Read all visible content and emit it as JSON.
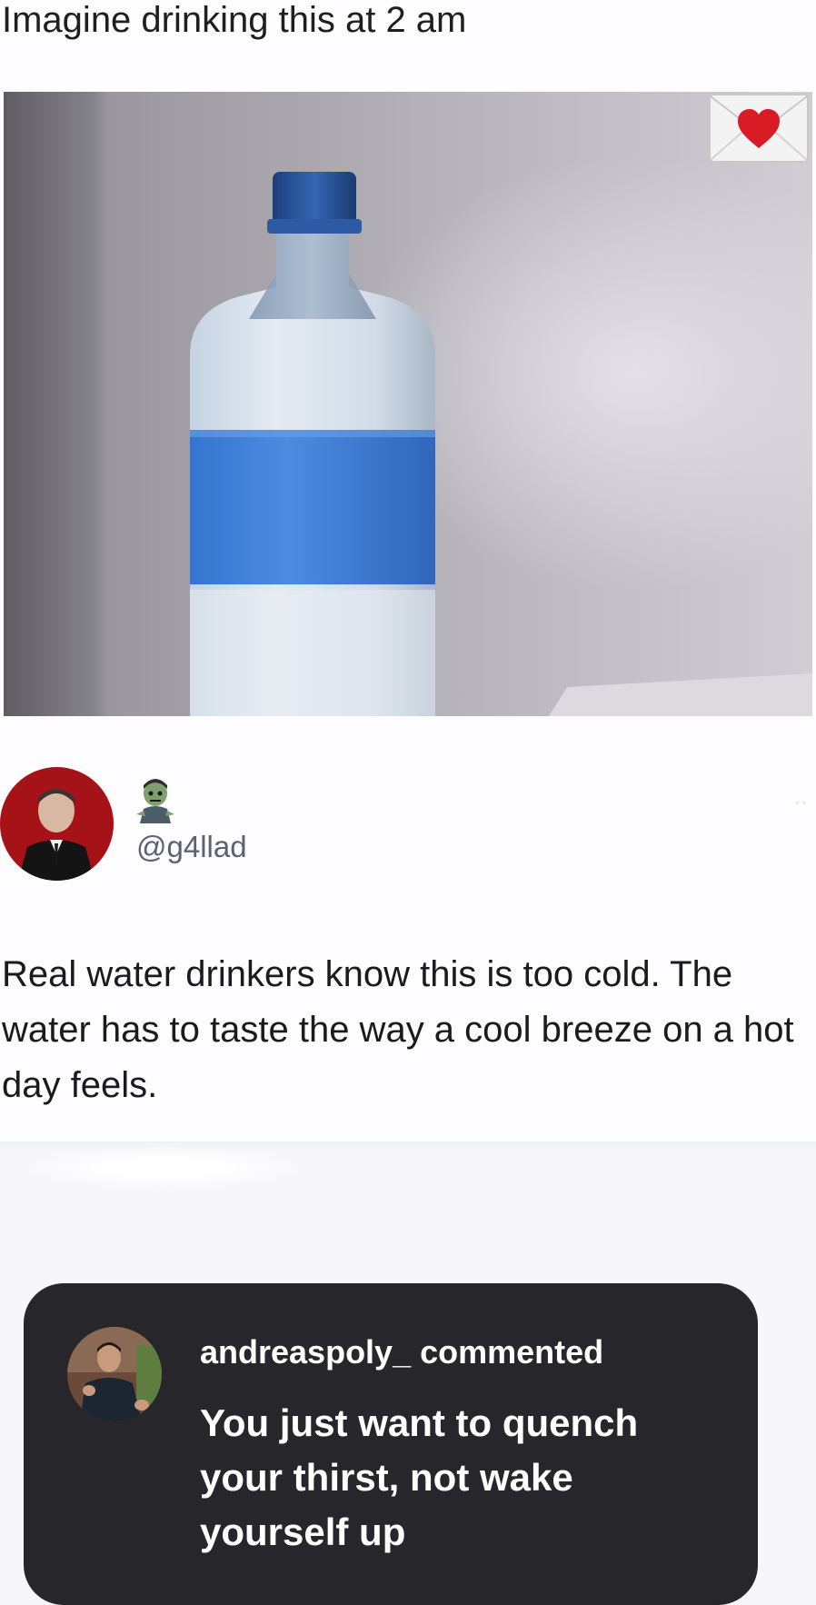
{
  "post": {
    "caption": "Imagine drinking this at 2 am",
    "image_subject": "bottle-of-water-photo",
    "reaction_icon": "love-letter-icon"
  },
  "tweet": {
    "display_name_icon": "zombie-emoji-icon",
    "handle": "@g4llad",
    "more_icon": "more-dots-icon",
    "text": "Real water drinkers know this is too cold. The water has to taste the way a cool breeze on a hot day feels."
  },
  "comment": {
    "author_line": "andreaspoly_ commented",
    "text": "You just want to quench your thirst, not wake yourself up"
  },
  "colors": {
    "background": "#f7f7fb",
    "card": "#27272b",
    "handle": "#5b6270",
    "label_blue": "#3d7fd6"
  }
}
